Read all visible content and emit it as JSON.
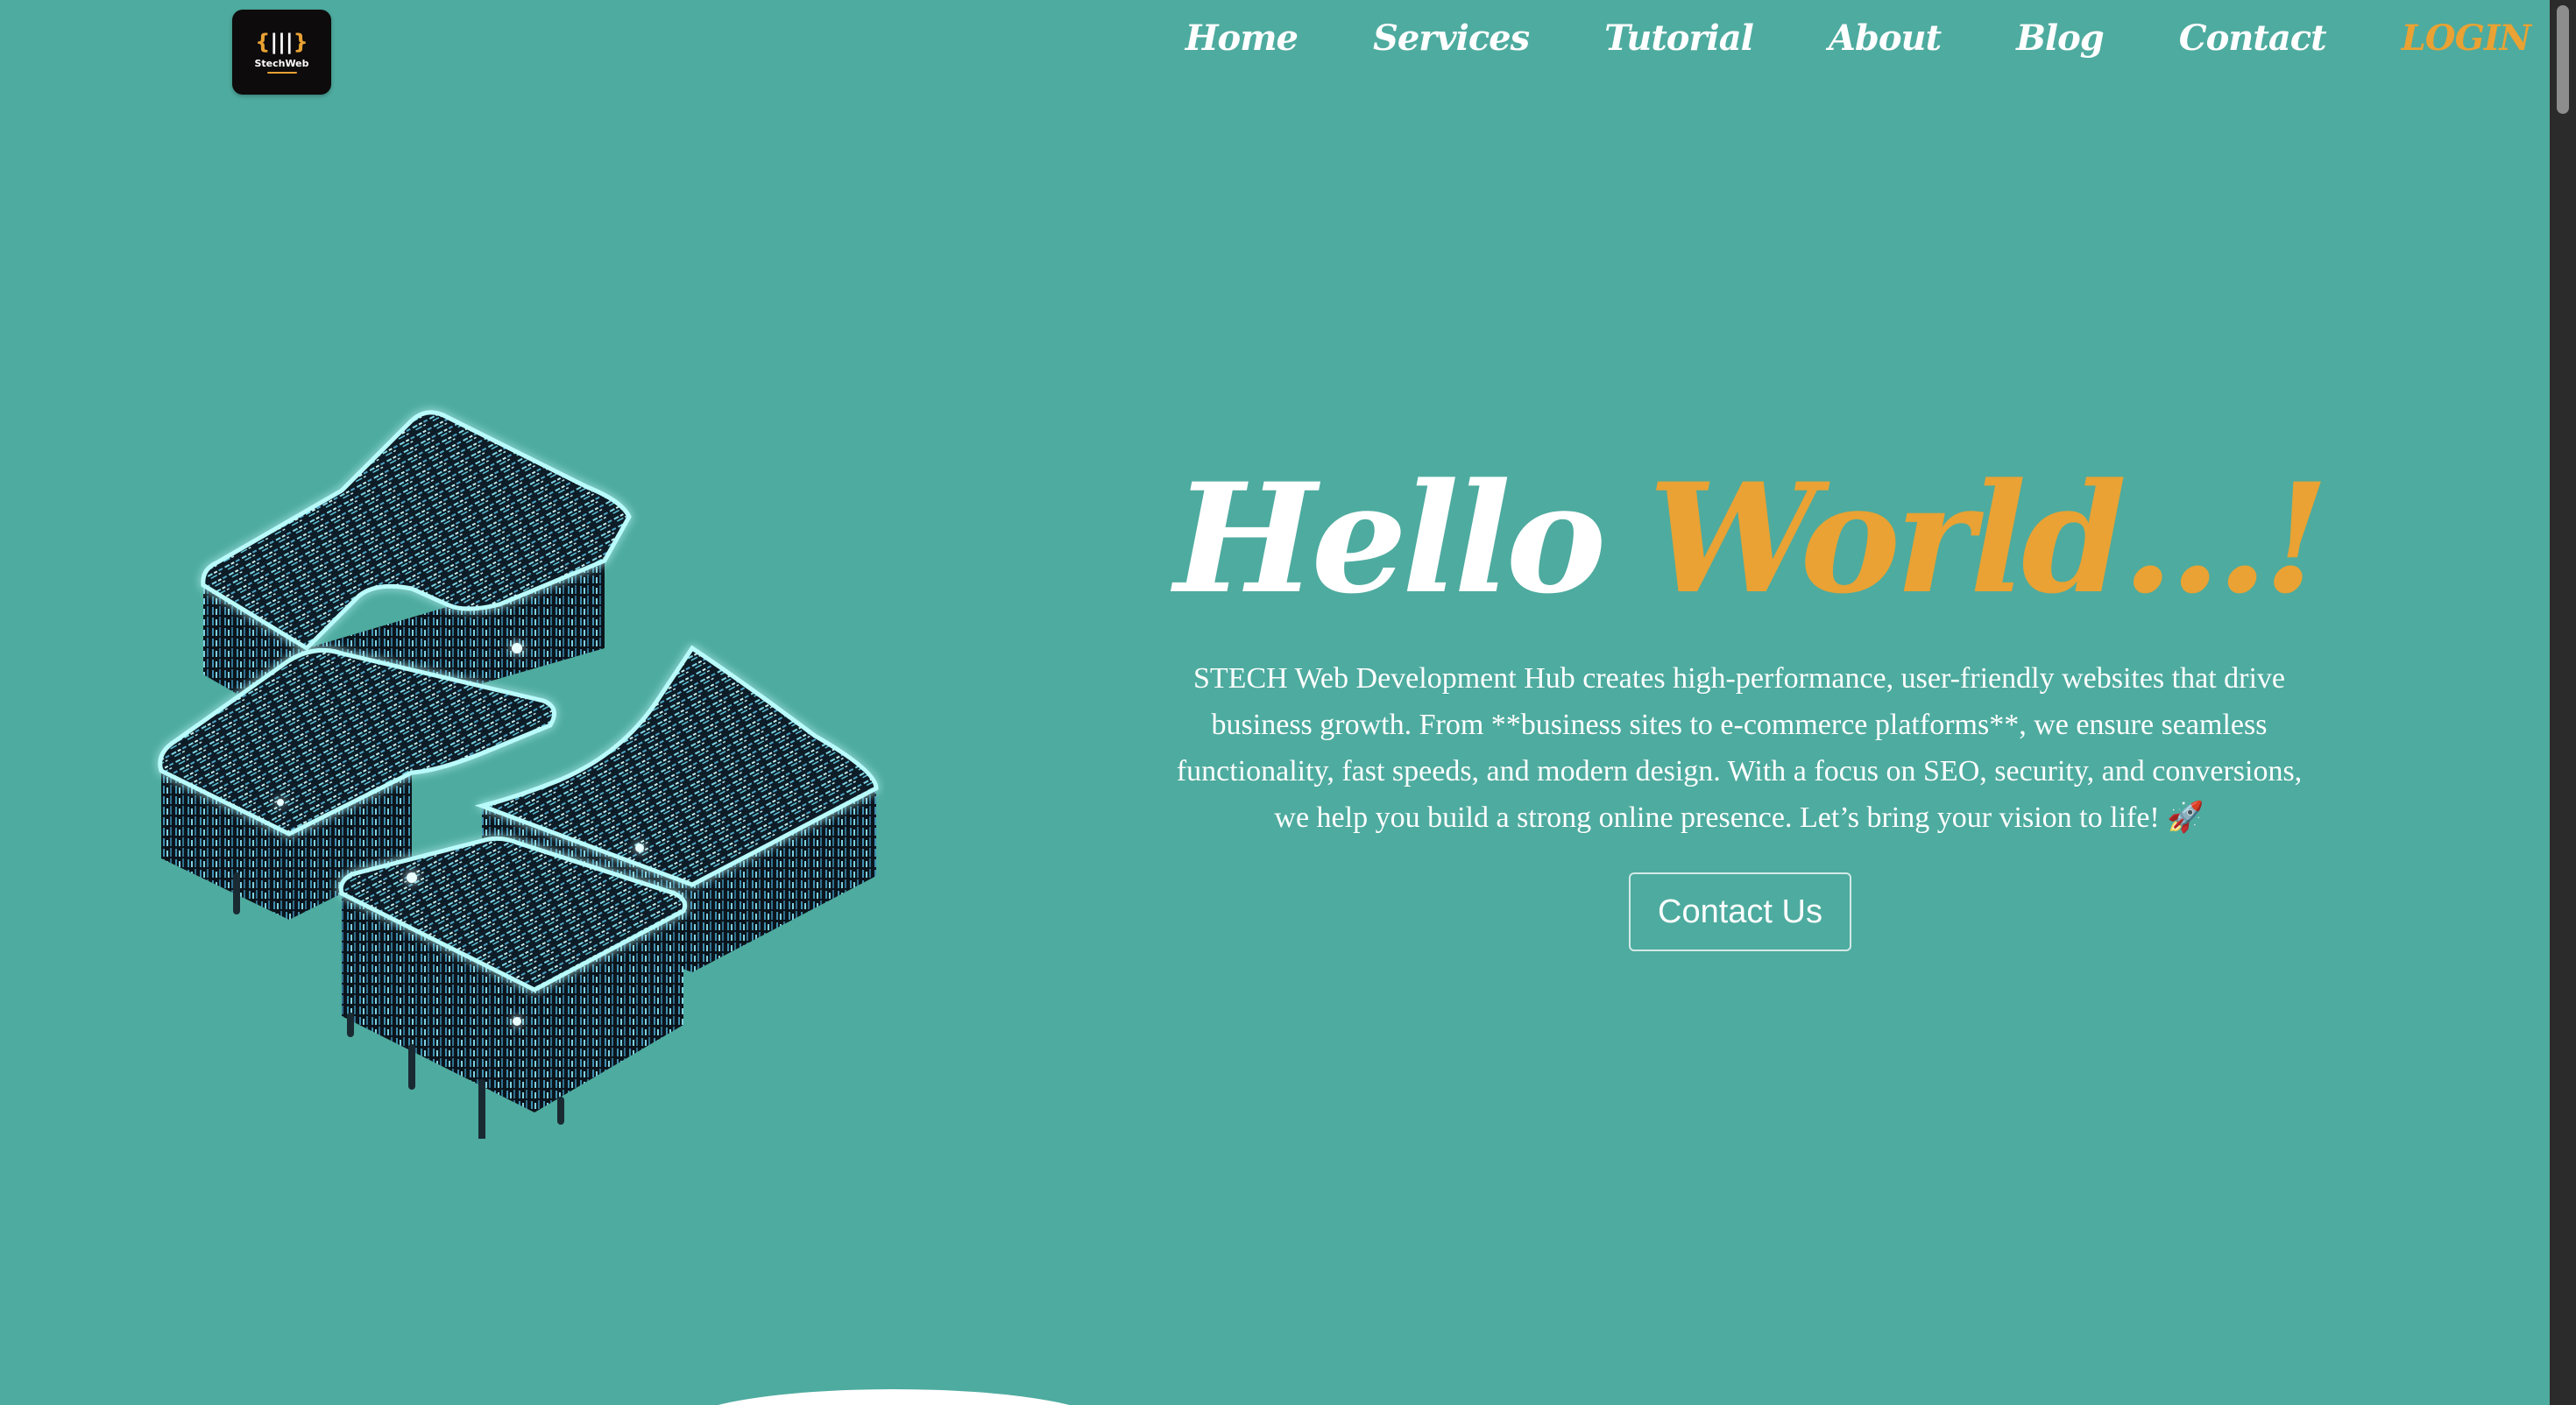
{
  "logo": {
    "mark_left": "{",
    "mark_bars": "|||",
    "mark_right": "}",
    "text": "StechWeb"
  },
  "nav": {
    "items": [
      {
        "label": "Home"
      },
      {
        "label": "Services"
      },
      {
        "label": "Tutorial"
      },
      {
        "label": "About"
      },
      {
        "label": "Blog"
      },
      {
        "label": "Contact"
      }
    ],
    "login": "LOGIN"
  },
  "hero": {
    "title_part1": "Hello ",
    "title_part2": "World...!",
    "description": "STECH Web Development Hub creates high-performance, user-friendly websites that drive business growth. From **business sites to e-commerce platforms**, we ensure seamless functionality, fast speeds, and modern design. With a focus on SEO, security, and conversions, we help you build a strong online presence. Let’s bring your vision to life! 🚀",
    "cta_label": "Contact Us"
  },
  "colors": {
    "background": "#4eab9f",
    "accent": "#e9a233",
    "text": "#ffffff",
    "art_dark": "#0f1a22",
    "art_glow": "#9ff3f3"
  },
  "icons": {
    "logo": "stechweb-logo-icon",
    "hero_art": "isometric-data-blocks-illustration"
  }
}
